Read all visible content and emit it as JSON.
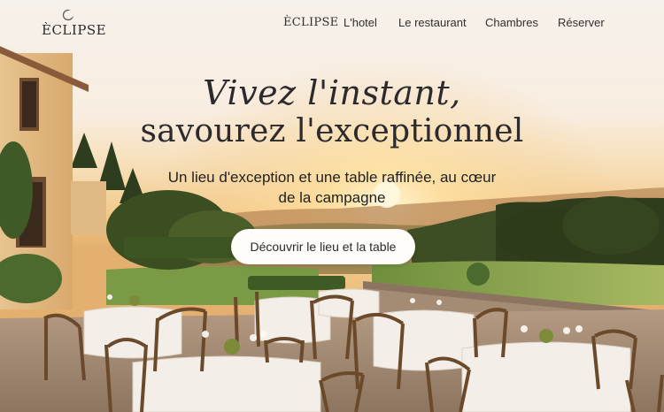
{
  "brand": {
    "logo_text": "ÈCLIPSE"
  },
  "nav": {
    "brand_label": "ÈCLIPSE",
    "items": [
      {
        "label": "L'hotel"
      },
      {
        "label": "Le restaurant"
      },
      {
        "label": "Chambres"
      },
      {
        "label": "Réserver"
      }
    ]
  },
  "hero": {
    "headline_line1": "Vivez l'instant,",
    "headline_line2": "savourez l'exceptionnel",
    "subtitle_line1": "Un lieu d'exception et une table raffinée, au cœur",
    "subtitle_line2": "de la campagne",
    "cta_label": "Découvrir le lieu et la table"
  },
  "colors": {
    "sky_top": "#f6f1ea",
    "sunset": "#f3c98a",
    "sun": "#fff2cf",
    "text_dark": "#2c2a2d",
    "button_bg": "#fffdf9"
  }
}
